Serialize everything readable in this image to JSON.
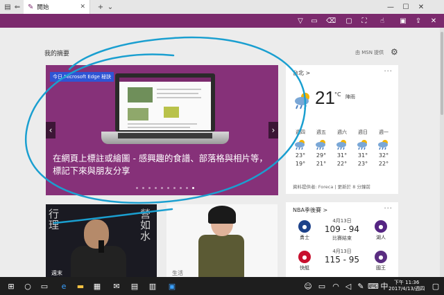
{
  "tab": {
    "title": "開始"
  },
  "feed": {
    "title": "我的摘要",
    "provider": "由 MSN 提供"
  },
  "hero": {
    "badge": "今日 Microsoft Edge 秘訣",
    "caption": "在網頁上標註或繪圖 - 感興趣的食譜、部落格與相片等，標記下來與朋友分享",
    "dots": 10,
    "active_dot": 9
  },
  "cards": [
    {
      "caption": "週末"
    },
    {
      "caption": "生活"
    }
  ],
  "weather": {
    "location": "台北 >",
    "temp": "21",
    "unit": "°C",
    "condition": "陣雨",
    "days": [
      {
        "name": "週四",
        "hi": "23°",
        "lo": "19°"
      },
      {
        "name": "週五",
        "hi": "29°",
        "lo": "21°"
      },
      {
        "name": "週六",
        "hi": "31°",
        "lo": "22°"
      },
      {
        "name": "週日",
        "hi": "31°",
        "lo": "23°"
      },
      {
        "name": "週一",
        "hi": "32°",
        "lo": "22°"
      }
    ],
    "source": "資料提供者: Foreca | 更新於 8 分鐘前"
  },
  "nba": {
    "title": "NBA季後賽 >",
    "games": [
      {
        "home": "勇士",
        "away": "湖人",
        "date": "4月13日",
        "score": "109 - 94",
        "status": "比賽結束",
        "home_color": "#1d428a",
        "away_color": "#552583"
      },
      {
        "home": "快艇",
        "away": "國王",
        "date": "4月13日",
        "score": "115 - 95",
        "status": "",
        "home_color": "#c8102e",
        "away_color": "#5a2d81"
      }
    ]
  },
  "clock": {
    "time": "下午 11:36",
    "date": "2017/4/13/週四"
  },
  "colors": {
    "accent": "#7b2a6d",
    "ink": "#1a9fd0"
  }
}
